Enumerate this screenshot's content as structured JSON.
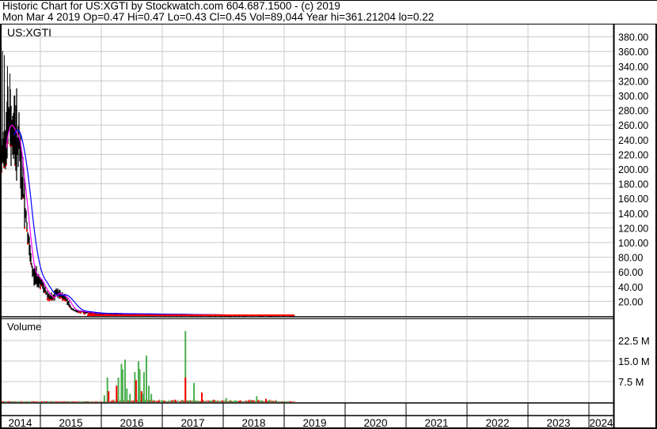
{
  "header": {
    "title": "Historic Chart for US:XGTI by Stockwatch.com 604.687.1500 - (c) 2019",
    "quote": "Mon Mar  4 2019  Op=0.47  Hi=0.47  Lo=0.43  Cl=0.45  Vol=89,044  Year hi=361.21204  lo=0.22"
  },
  "chart_data": {
    "type": "line",
    "symbol": "US:XGTI",
    "volume_label": "Volume",
    "x_ticks": [
      "2014",
      "2015",
      "2016",
      "2017",
      "2018",
      "2019",
      "2020",
      "2021",
      "2022",
      "2023",
      "2024"
    ],
    "price_ticks": [
      "20.00",
      "40.00",
      "60.00",
      "80.00",
      "100.00",
      "120.00",
      "140.00",
      "160.00",
      "180.00",
      "200.00",
      "220.00",
      "240.00",
      "260.00",
      "280.00",
      "300.00",
      "320.00",
      "340.00",
      "360.00",
      "380.00"
    ],
    "price_ylim": [
      0,
      390
    ],
    "volume_ticks": [
      "7.5 M",
      "15.0 M",
      "22.5 M"
    ],
    "volume_ylim_millions": [
      0,
      30
    ],
    "price_series": [
      [
        2014.36,
        200
      ],
      [
        2014.4,
        235
      ],
      [
        2014.44,
        255
      ],
      [
        2014.48,
        262
      ],
      [
        2014.52,
        258
      ],
      [
        2014.56,
        250
      ],
      [
        2014.6,
        245
      ],
      [
        2014.64,
        238
      ],
      [
        2014.68,
        200
      ],
      [
        2014.72,
        170
      ],
      [
        2014.76,
        140
      ],
      [
        2014.8,
        105
      ],
      [
        2014.84,
        75
      ],
      [
        2014.88,
        58
      ],
      [
        2014.92,
        55
      ],
      [
        2014.96,
        52
      ],
      [
        2015.0,
        48
      ],
      [
        2015.05,
        38
      ],
      [
        2015.1,
        32
      ],
      [
        2015.15,
        26
      ],
      [
        2015.2,
        24
      ],
      [
        2015.25,
        32
      ],
      [
        2015.3,
        30
      ],
      [
        2015.35,
        28
      ],
      [
        2015.4,
        26
      ],
      [
        2015.45,
        20
      ],
      [
        2015.5,
        12
      ],
      [
        2015.55,
        8
      ],
      [
        2015.6,
        7
      ],
      [
        2015.7,
        6
      ],
      [
        2015.8,
        5
      ],
      [
        2015.9,
        4
      ],
      [
        2016.0,
        3.5
      ],
      [
        2016.5,
        3
      ],
      [
        2017.0,
        2.5
      ],
      [
        2017.5,
        2
      ],
      [
        2018.0,
        1.5
      ],
      [
        2018.5,
        1
      ],
      [
        2019.0,
        0.6
      ],
      [
        2019.17,
        0.45
      ]
    ],
    "price_highs": [
      [
        2014.38,
        361
      ],
      [
        2014.41,
        355
      ],
      [
        2014.46,
        340
      ],
      [
        2014.5,
        330
      ],
      [
        2014.58,
        300
      ]
    ],
    "volume_millions": [
      [
        2016.05,
        2.5,
        "up"
      ],
      [
        2016.1,
        9,
        "up"
      ],
      [
        2016.12,
        4,
        "down"
      ],
      [
        2016.25,
        6,
        "down"
      ],
      [
        2016.28,
        9,
        "up"
      ],
      [
        2016.33,
        14,
        "up"
      ],
      [
        2016.35,
        12,
        "up"
      ],
      [
        2016.39,
        15.5,
        "up"
      ],
      [
        2016.42,
        5,
        "up"
      ],
      [
        2016.47,
        3,
        "up"
      ],
      [
        2016.55,
        11,
        "up"
      ],
      [
        2016.57,
        8,
        "down"
      ],
      [
        2016.61,
        15,
        "up"
      ],
      [
        2016.63,
        12,
        "up"
      ],
      [
        2016.66,
        4,
        "down"
      ],
      [
        2016.68,
        3,
        "up"
      ],
      [
        2016.7,
        11,
        "up"
      ],
      [
        2016.74,
        17,
        "up"
      ],
      [
        2016.78,
        6,
        "up"
      ],
      [
        2016.82,
        3,
        "up"
      ],
      [
        2017.38,
        26,
        "up"
      ],
      [
        2017.38,
        9,
        "down"
      ],
      [
        2017.52,
        7,
        "up"
      ],
      [
        2017.65,
        3.5,
        "down"
      ],
      [
        2018.05,
        1.5,
        "up"
      ],
      [
        2018.55,
        2.2,
        "up"
      ],
      [
        2018.7,
        1.2,
        "down"
      ]
    ]
  },
  "colors": {
    "price": "#000000",
    "down": "#ff0000",
    "up": "#4caf50",
    "ma_short": "#ff00ff",
    "ma_long": "#0000ff",
    "grid": "#c8c8c8"
  }
}
